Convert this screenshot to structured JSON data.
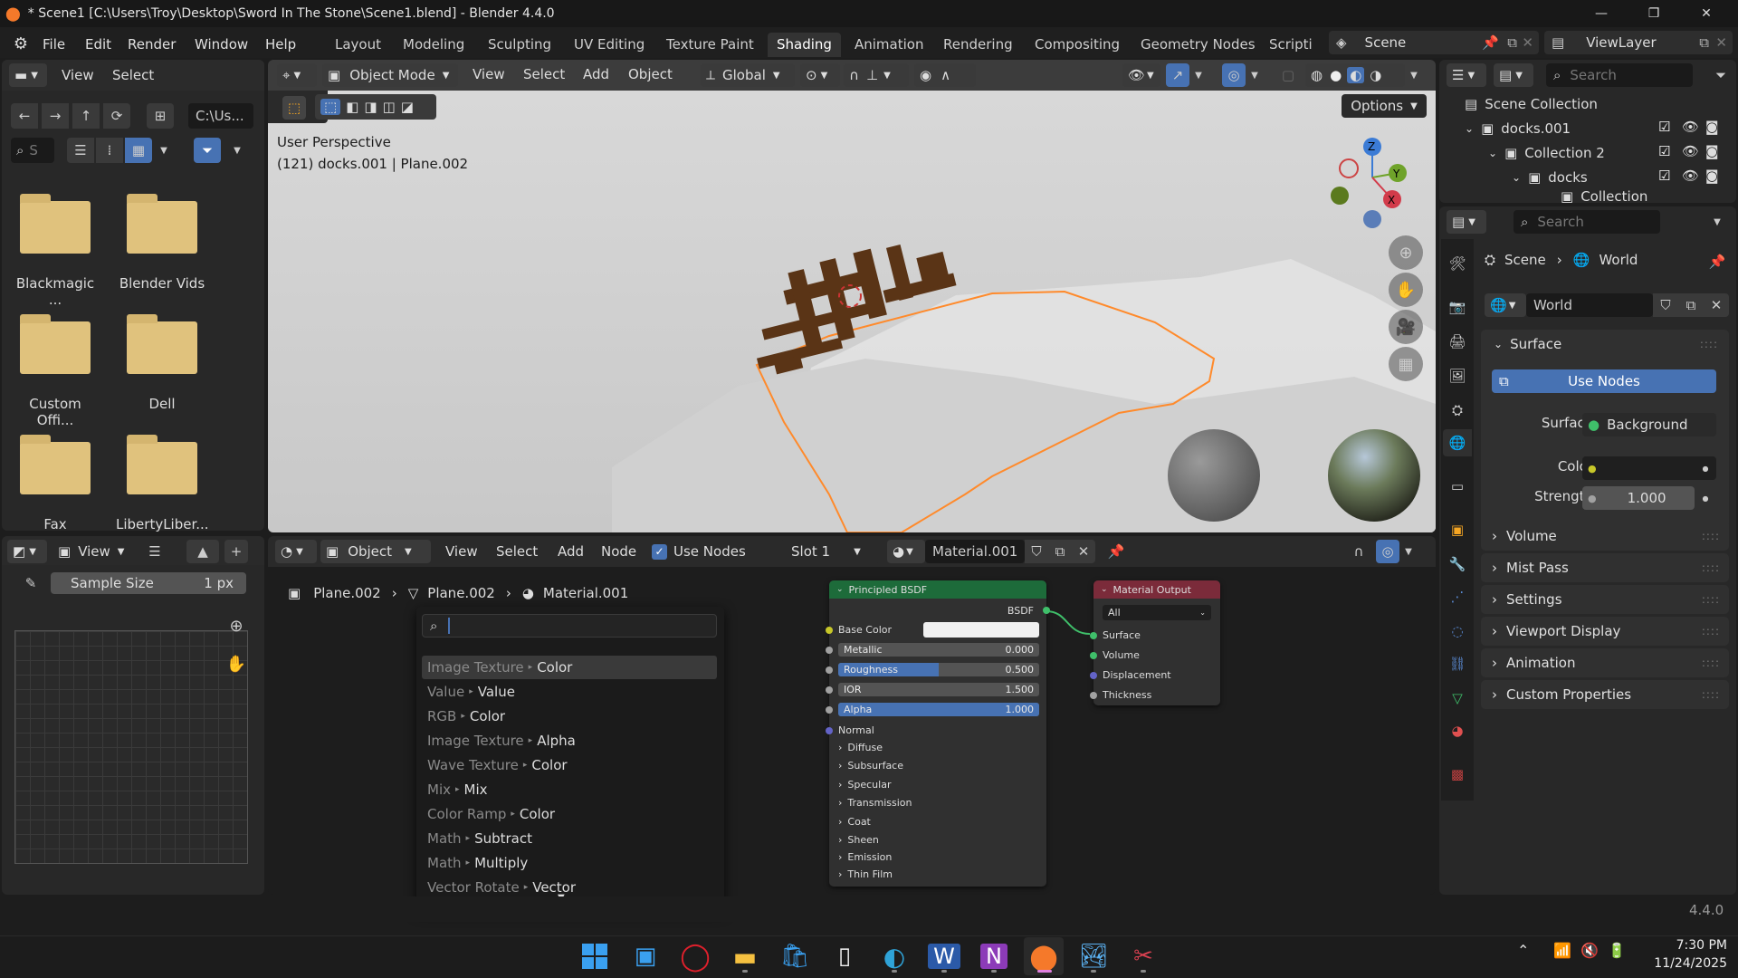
{
  "window": {
    "title": "* Scene1 [C:\\Users\\Troy\\Desktop\\Sword In The Stone\\Scene1.blend] - Blender 4.4.0"
  },
  "menu": {
    "file": "File",
    "edit": "Edit",
    "render": "Render",
    "window": "Window",
    "help": "Help"
  },
  "workspaces": [
    "Layout",
    "Modeling",
    "Sculpting",
    "UV Editing",
    "Texture Paint",
    "Shading",
    "Animation",
    "Rendering",
    "Compositing",
    "Geometry Nodes",
    "Scripti"
  ],
  "active_workspace": "Shading",
  "scene_selector": {
    "scene": "Scene",
    "view_layer": "ViewLayer"
  },
  "file_browser": {
    "view": "View",
    "select": "Select",
    "path": "C:\\Us...",
    "search_placeholder": "S",
    "folders": [
      "Blackmagic ...",
      "Blender Vids",
      "Custom Offi...",
      "Dell",
      "Fax",
      "LibertyLiber..."
    ]
  },
  "viewport": {
    "mode": "Object Mode",
    "view": "View",
    "select": "Select",
    "add": "Add",
    "object": "Object",
    "orientation": "Global",
    "options": "Options",
    "info_line1": "User Perspective",
    "info_line2": "(121) docks.001 | Plane.002"
  },
  "outliner": {
    "search_placeholder": "Search",
    "items": [
      {
        "label": "Scene Collection"
      },
      {
        "label": "docks.001"
      },
      {
        "label": "Collection 2"
      },
      {
        "label": "docks"
      },
      {
        "label": "Collection"
      }
    ]
  },
  "properties": {
    "search_placeholder": "Search",
    "breadcrumb_scene": "Scene",
    "breadcrumb_world": "World",
    "world_name": "World",
    "surface_header": "Surface",
    "use_nodes": "Use Nodes",
    "surface_label": "Surface",
    "surface_value": "Background",
    "color_label": "Color",
    "strength_label": "Strength",
    "strength_value": "1.000",
    "sections": [
      "Volume",
      "Mist Pass",
      "Settings",
      "Viewport Display",
      "Animation",
      "Custom Properties"
    ]
  },
  "image_editor": {
    "view": "View",
    "sample_size_label": "Sample Size",
    "sample_size_value": "1 px"
  },
  "node_editor": {
    "editor_type": "Object",
    "view": "View",
    "select": "Select",
    "add": "Add",
    "node": "Node",
    "use_nodes": "Use Nodes",
    "slot": "Slot 1",
    "material": "Material.001",
    "breadcrumb": [
      "Plane.002",
      "Plane.002",
      "Material.001"
    ]
  },
  "search_menu": {
    "query": "",
    "results": [
      {
        "prefix": "Image Texture",
        "name": "Color"
      },
      {
        "prefix": "Value",
        "name": "Value"
      },
      {
        "prefix": "RGB",
        "name": "Color"
      },
      {
        "prefix": "Image Texture",
        "name": "Alpha"
      },
      {
        "prefix": "Wave Texture",
        "name": "Color"
      },
      {
        "prefix": "Mix",
        "name": "Mix"
      },
      {
        "prefix": "Color Ramp",
        "name": "Color"
      },
      {
        "prefix": "Math",
        "name": "Subtract"
      },
      {
        "prefix": "Math",
        "name": "Multiply"
      },
      {
        "prefix": "Vector Rotate",
        "name": "Vector"
      }
    ]
  },
  "principled_bsdf": {
    "title": "Principled BSDF",
    "output": "BSDF",
    "base_color": "Base Color",
    "metallic_label": "Metallic",
    "metallic": "0.000",
    "roughness_label": "Roughness",
    "roughness": "0.500",
    "roughness_fraction": 0.5,
    "ior_label": "IOR",
    "ior": "1.500",
    "alpha_label": "Alpha",
    "alpha": "1.000",
    "alpha_fraction": 1.0,
    "normal": "Normal",
    "panels": [
      "Diffuse",
      "Subsurface",
      "Specular",
      "Transmission",
      "Coat",
      "Sheen",
      "Emission",
      "Thin Film"
    ]
  },
  "material_output": {
    "title": "Material Output",
    "target": "All",
    "inputs": [
      "Surface",
      "Volume",
      "Displacement",
      "Thickness"
    ]
  },
  "status": {
    "version": "4.4.0"
  },
  "taskbar": {
    "time": "7:30 PM",
    "date": "11/24/2025"
  },
  "colors": {
    "accent": "#4772b3",
    "node_header_green": "#1d6b3a",
    "node_header_red": "#7b2b3a",
    "socket_yellow": "#c7c729",
    "socket_grey": "#a1a1a1",
    "socket_purple": "#6363c7",
    "selection_orange": "#ff8a2b"
  }
}
